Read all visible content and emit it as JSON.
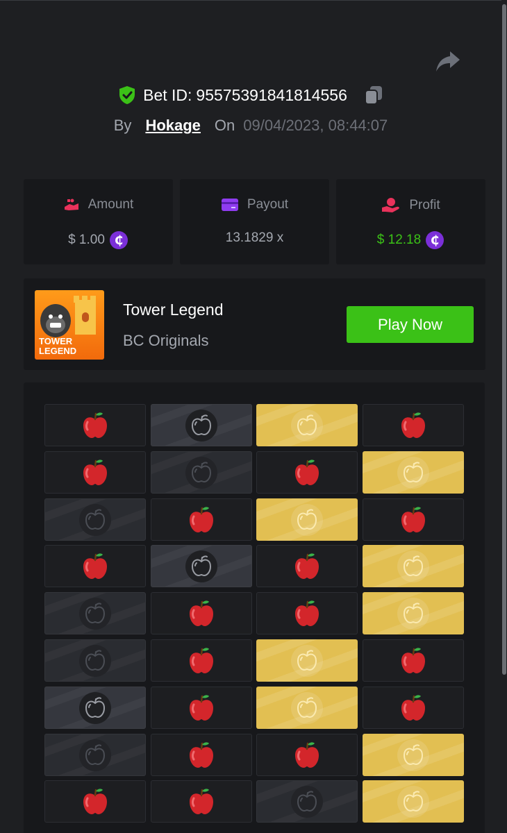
{
  "bet": {
    "label": "Bet ID:",
    "id": "95575391841814556",
    "by_label": "By",
    "user": "Hokage",
    "on_label": "On",
    "date": "09/04/2023, 08:44:07"
  },
  "stats": [
    {
      "label": "Amount",
      "value": "$ 1.00",
      "icon": "bet-amount-icon",
      "currency_icon": "coin-icon"
    },
    {
      "label": "Payout",
      "value": "13.1829 x",
      "icon": "card-icon"
    },
    {
      "label": "Profit",
      "value": "$ 12.18",
      "icon": "profit-hand-icon",
      "currency_icon": "coin-icon"
    }
  ],
  "game": {
    "title": "Tower Legend",
    "provider": "BC Originals",
    "play_label": "Play Now",
    "thumb_text_line1": "TOWER",
    "thumb_text_line2": "LEGEND"
  },
  "colors": {
    "accent_green": "#3bc117",
    "gold": "#e2bf52",
    "apple_red": "#d3262b",
    "coin_purple": "#7b2fd8"
  },
  "board": {
    "columns": 4,
    "rows": [
      [
        "apple",
        "revealed",
        "picked",
        "apple"
      ],
      [
        "apple",
        "dim",
        "apple",
        "picked"
      ],
      [
        "dim",
        "apple",
        "picked",
        "apple"
      ],
      [
        "apple",
        "revealed",
        "apple",
        "picked"
      ],
      [
        "dim",
        "apple",
        "apple",
        "picked"
      ],
      [
        "dim",
        "apple",
        "picked",
        "apple"
      ],
      [
        "revealed",
        "apple",
        "picked",
        "apple"
      ],
      [
        "dim",
        "apple",
        "apple",
        "picked"
      ],
      [
        "apple",
        "apple",
        "dim",
        "picked"
      ]
    ]
  }
}
